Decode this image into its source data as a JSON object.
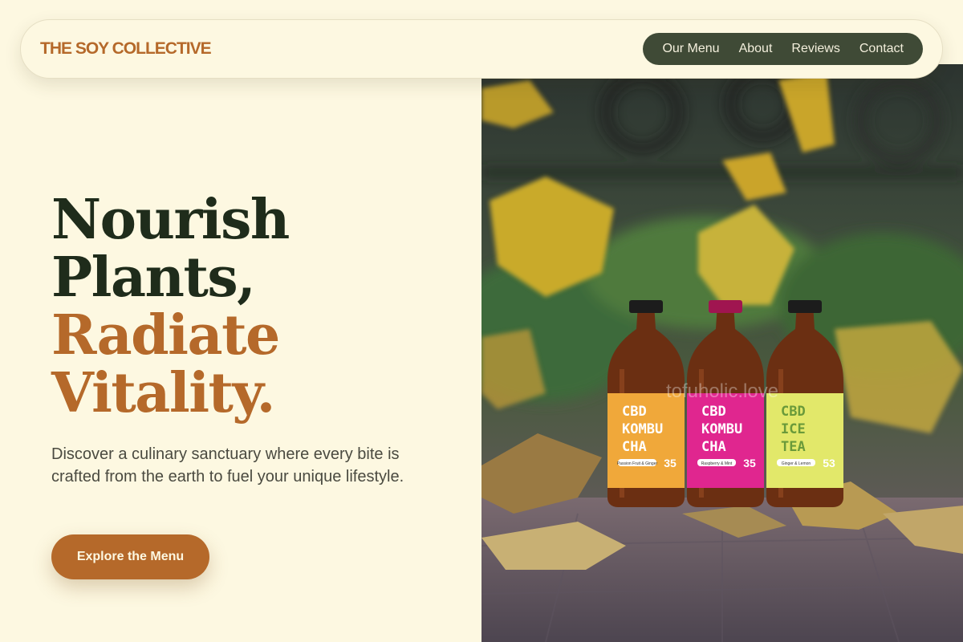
{
  "brand": {
    "name": "THE SOY COLLECTIVE"
  },
  "nav": {
    "items": [
      {
        "label": "Our Menu"
      },
      {
        "label": "About"
      },
      {
        "label": "Reviews"
      },
      {
        "label": "Contact"
      }
    ]
  },
  "hero": {
    "headline_line1": "Nourish",
    "headline_line2": "Plants,",
    "headline_line3": "Radiate",
    "headline_line4": "Vitality.",
    "tagline": "Discover a culinary sanctuary where every bite is crafted from the earth to fuel your unique lifestyle.",
    "cta_label": "Explore the Menu"
  },
  "photo": {
    "watermark": "tofuholic.love",
    "bottles": [
      {
        "line1": "CBD",
        "line2": "KOMBU",
        "line3": "CHA",
        "number": "35",
        "tag": "Passion Fruit & Ginger",
        "color": "#f0a83a"
      },
      {
        "line1": "CBD",
        "line2": "KOMBU",
        "line3": "CHA",
        "number": "35",
        "tag": "Raspberry & Mint",
        "color": "#e0268f"
      },
      {
        "line1": "CBD",
        "line2": "ICE",
        "line3": "TEA",
        "number": "53",
        "tag": "Ginger & Lemon",
        "color": "#e2e86a"
      }
    ]
  },
  "colors": {
    "background": "#fdf8e1",
    "accent": "#b5692a",
    "dark_green": "#1f2c1b",
    "nav_bg": "#3f4a36"
  }
}
